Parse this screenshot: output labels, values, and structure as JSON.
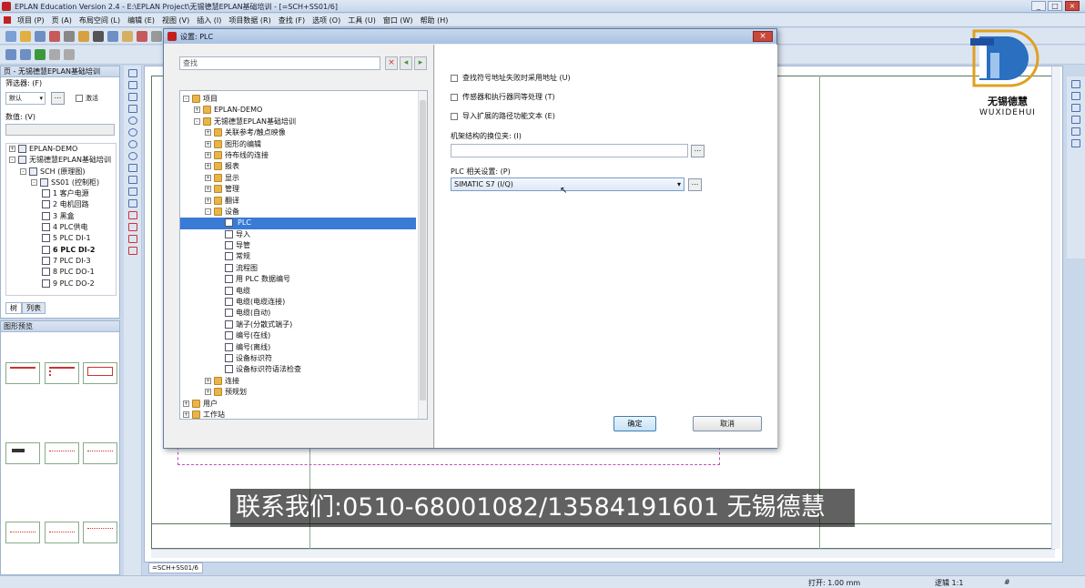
{
  "window": {
    "title": "EPLAN Education Version 2.4 - E:\\EPLAN Project\\无锡德慧EPLAN基础培训 - [=SCH+SS01/6]",
    "controls": [
      "_",
      "□",
      "×"
    ]
  },
  "menubar": {
    "items": [
      "项目 (P)",
      "页 (A)",
      "布局空间 (L)",
      "编辑 (E)",
      "视图 (V)",
      "插入 (I)",
      "项目数据 (R)",
      "查找 (F)",
      "选项 (O)",
      "工具 (U)",
      "窗口 (W)",
      "帮助 (H)"
    ]
  },
  "page_panel": {
    "title": "页 - 无锡德慧EPLAN基础培训",
    "filter_label": "筛选器: (F)",
    "filter_value": "默认",
    "activate_label": "激活",
    "value_label": "数值: (V)",
    "tree": [
      {
        "label": "EPLAN-DEMO",
        "level": 0,
        "exp": "+",
        "icon": "proj",
        "bold": false
      },
      {
        "label": "无锡德慧EPLAN基础培训",
        "level": 0,
        "exp": "−",
        "icon": "proj",
        "bold": false
      },
      {
        "label": "SCH (原理图)",
        "level": 1,
        "exp": "−",
        "icon": "proj",
        "bold": false
      },
      {
        "label": "SS01 (控制柜)",
        "level": 2,
        "exp": "−",
        "icon": "proj",
        "bold": false
      },
      {
        "label": "1 客户电源",
        "level": 3,
        "exp": "",
        "icon": "page",
        "bold": false
      },
      {
        "label": "2 电机回路",
        "level": 3,
        "exp": "",
        "icon": "page",
        "bold": false
      },
      {
        "label": "3 黑盒",
        "level": 3,
        "exp": "",
        "icon": "page",
        "bold": false
      },
      {
        "label": "4 PLC供电",
        "level": 3,
        "exp": "",
        "icon": "page",
        "bold": false
      },
      {
        "label": "5 PLC DI-1",
        "level": 3,
        "exp": "",
        "icon": "page",
        "bold": false
      },
      {
        "label": "6 PLC DI-2",
        "level": 3,
        "exp": "",
        "icon": "page",
        "bold": true
      },
      {
        "label": "7 PLC DI-3",
        "level": 3,
        "exp": "",
        "icon": "page",
        "bold": false
      },
      {
        "label": "8 PLC DO-1",
        "level": 3,
        "exp": "",
        "icon": "page",
        "bold": false
      },
      {
        "label": "9 PLC DO-2",
        "level": 3,
        "exp": "",
        "icon": "page",
        "bold": false
      }
    ],
    "tabs": [
      "树",
      "列表"
    ]
  },
  "thumb_panel": {
    "title": "图形预览"
  },
  "dialog": {
    "title": "设置: PLC",
    "search_placeholder": "查找",
    "tree": [
      {
        "label": "项目",
        "level": 0,
        "exp": "−",
        "icon": "folder",
        "sel": false
      },
      {
        "label": "EPLAN-DEMO",
        "level": 1,
        "exp": "+",
        "icon": "folder",
        "sel": false
      },
      {
        "label": "无锡德慧EPLAN基础培训",
        "level": 1,
        "exp": "−",
        "icon": "folder",
        "sel": false
      },
      {
        "label": "关联参考/触点映像",
        "level": 2,
        "exp": "+",
        "icon": "folder",
        "sel": false
      },
      {
        "label": "图形的编辑",
        "level": 2,
        "exp": "+",
        "icon": "folder",
        "sel": false
      },
      {
        "label": "待布线的连接",
        "level": 2,
        "exp": "+",
        "icon": "folder",
        "sel": false
      },
      {
        "label": "报表",
        "level": 2,
        "exp": "+",
        "icon": "folder",
        "sel": false
      },
      {
        "label": "显示",
        "level": 2,
        "exp": "+",
        "icon": "folder",
        "sel": false
      },
      {
        "label": "管理",
        "level": 2,
        "exp": "+",
        "icon": "folder",
        "sel": false
      },
      {
        "label": "翻译",
        "level": 2,
        "exp": "+",
        "icon": "folder",
        "sel": false
      },
      {
        "label": "设备",
        "level": 2,
        "exp": "−",
        "icon": "folder",
        "sel": false
      },
      {
        "label": "PLC",
        "level": 3,
        "exp": "",
        "icon": "page",
        "sel": true
      },
      {
        "label": "导入",
        "level": 3,
        "exp": "",
        "icon": "page",
        "sel": false
      },
      {
        "label": "导管",
        "level": 3,
        "exp": "",
        "icon": "page",
        "sel": false
      },
      {
        "label": "常规",
        "level": 3,
        "exp": "",
        "icon": "page",
        "sel": false
      },
      {
        "label": "流程图",
        "level": 3,
        "exp": "",
        "icon": "page",
        "sel": false
      },
      {
        "label": "用 PLC 数据编号",
        "level": 3,
        "exp": "",
        "icon": "page",
        "sel": false
      },
      {
        "label": "电缆",
        "level": 3,
        "exp": "",
        "icon": "page",
        "sel": false
      },
      {
        "label": "电缆(电缆连接)",
        "level": 3,
        "exp": "",
        "icon": "page",
        "sel": false
      },
      {
        "label": "电缆(自动)",
        "level": 3,
        "exp": "",
        "icon": "page",
        "sel": false
      },
      {
        "label": "端子(分散式端子)",
        "level": 3,
        "exp": "",
        "icon": "page",
        "sel": false
      },
      {
        "label": "编号(在线)",
        "level": 3,
        "exp": "",
        "icon": "page",
        "sel": false
      },
      {
        "label": "编号(离线)",
        "level": 3,
        "exp": "",
        "icon": "page",
        "sel": false
      },
      {
        "label": "设备标识符",
        "level": 3,
        "exp": "",
        "icon": "page",
        "sel": false
      },
      {
        "label": "设备标识符语法检查",
        "level": 3,
        "exp": "",
        "icon": "page",
        "sel": false
      },
      {
        "label": "连接",
        "level": 2,
        "exp": "+",
        "icon": "folder",
        "sel": false
      },
      {
        "label": "预规划",
        "level": 2,
        "exp": "+",
        "icon": "folder",
        "sel": false
      },
      {
        "label": "用户",
        "level": 0,
        "exp": "+",
        "icon": "folder",
        "sel": false
      },
      {
        "label": "工作站",
        "level": 0,
        "exp": "+",
        "icon": "folder",
        "sel": false
      }
    ],
    "options": [
      "查找符号地址失败时采用地址 (U)",
      "传感器和执行器同等处理 (T)",
      "导入扩展的路径功能文本 (E)"
    ],
    "rack_label": "机架结构的换位夹: (I)",
    "rack_value": "",
    "plc_label": "PLC 相关设置: (P)",
    "plc_value": "SIMATIC S7 (I/Q)",
    "ok_label": "确定",
    "cancel_label": "取消"
  },
  "banner": {
    "text": "联系我们:0510-68001082/13584191601 无锡德慧"
  },
  "logo": {
    "name": "无锡德慧",
    "latin": "WUXIDEHUI"
  },
  "tab": {
    "label": "=SCH+SS01/6"
  },
  "statusbar": {
    "open": "打开: 1.00 mm",
    "logic": "逻辑 1:1",
    "hash": "#"
  },
  "colors": {
    "accent": "#3a7bd5",
    "brand_red": "#c02020"
  }
}
